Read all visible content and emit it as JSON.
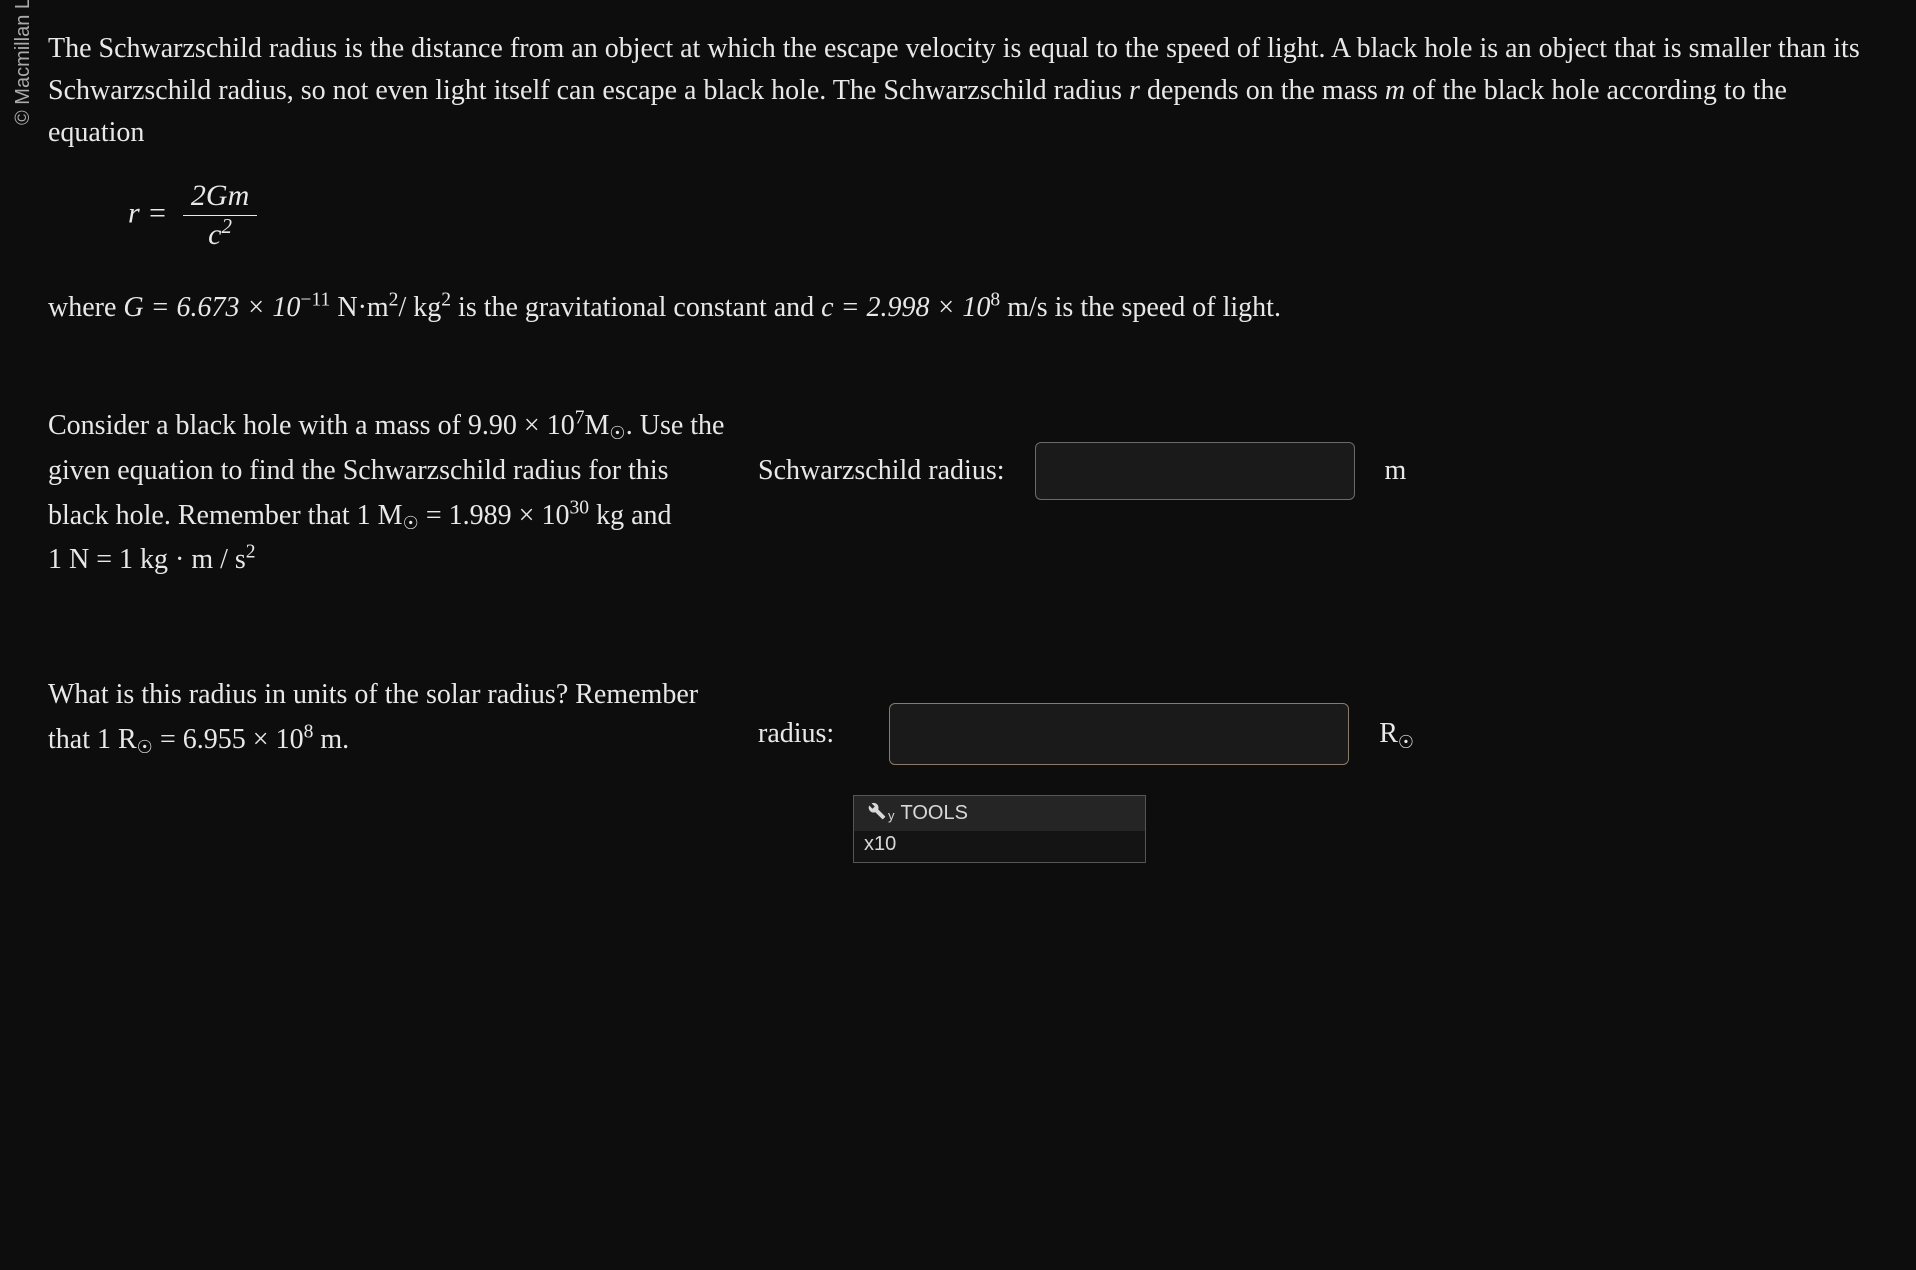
{
  "copyright": "© Macmillan Learning",
  "intro": {
    "p1_a": "The Schwarzschild radius is the distance from an object at which the escape velocity is equal to the speed of light. A black hole is an object that is smaller than its Schwarzschild radius, so not even light itself can escape a black hole. The Schwarzschild radius ",
    "p1_r": "r",
    "p1_b": " depends on the mass ",
    "p1_m": "m",
    "p1_c": " of the black hole according to the equation"
  },
  "equation": {
    "lhs": "r =",
    "num": "2Gm",
    "den_base": "c",
    "den_exp": "2"
  },
  "constants": {
    "pre": "where ",
    "G_eq": "G = 6.673 × 10",
    "G_exp": "−11",
    "G_unit_a": " N·m",
    "G_unit_a_exp": "2",
    "G_unit_b": "/ kg",
    "G_unit_b_exp": "2",
    "mid": " is the gravitational constant and ",
    "c_eq": "c = 2.998 × 10",
    "c_exp": "8",
    "c_unit": " m/s is the speed of light."
  },
  "q1": {
    "line1_a": "Consider a black hole with a mass of 9.90 × 10",
    "line1_exp": "7",
    "line1_b": "M",
    "line1_sun": "☉",
    "line1_c": ". Use the given equation to find the Schwarzschild radius for this black hole. Remember that 1 M",
    "line1_sun2": "☉",
    "line1_d": " = 1.989 × 10",
    "line1_exp2": "30",
    "line1_e": " kg and",
    "line2_a": "1 N = 1 kg · m / s",
    "line2_exp": "2",
    "answer_label": "Schwarzschild radius:",
    "answer_unit": "m"
  },
  "q2": {
    "line1_a": "What is this radius in units of the solar radius? Remember that 1 R",
    "line1_sun": "☉",
    "line1_b": " = 6.955 × 10",
    "line1_exp": "8",
    "line1_c": " m.",
    "answer_label": "radius:",
    "answer_unit_base": "R",
    "answer_unit_sub": "☉"
  },
  "tools": {
    "header": "TOOLS",
    "header_sub": "y",
    "body_a": "x10"
  }
}
